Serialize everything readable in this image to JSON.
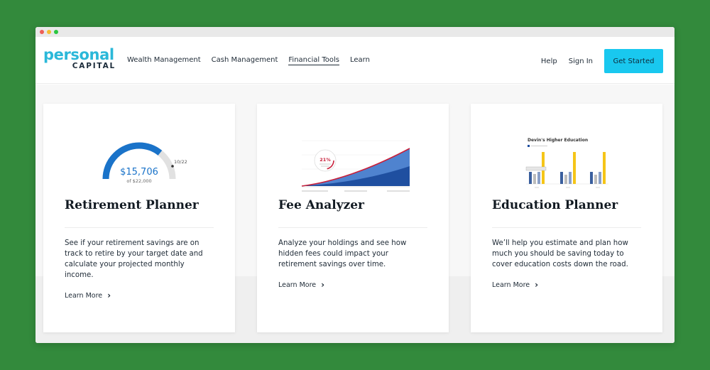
{
  "brand": {
    "logo_top": "personal",
    "logo_bottom": "CAPITAL",
    "logo_color": "#2bb8d9"
  },
  "nav": {
    "links": [
      "Wealth Management",
      "Cash Management",
      "Financial Tools",
      "Learn"
    ],
    "active": "Financial Tools",
    "help": "Help",
    "sign_in": "Sign In",
    "cta": "Get Started",
    "cta_color": "#19c8ef"
  },
  "cards": [
    {
      "title": "Retirement Planner",
      "description": "See if your retirement savings are on track to retire by your target date and calculate your projected monthly income.",
      "learn_more": "Learn More",
      "graphic": {
        "amount": "$15,706",
        "goal": "of $22,000",
        "marker": "10/22",
        "progress": 0.714,
        "color": "#1a73c9"
      }
    },
    {
      "title": "Fee Analyzer",
      "description": "Analyze your holdings and see how hidden fees could impact your retirement savings over time.",
      "learn_more": "Learn More",
      "graphic": {
        "percent": "21%"
      }
    },
    {
      "title": "Education Planner",
      "description": "We’ll help you estimate and plan how much you should be saving today to cover education costs down the road.",
      "learn_more": "Learn More",
      "graphic": {
        "title": "Devin's Higher Education"
      }
    }
  ]
}
